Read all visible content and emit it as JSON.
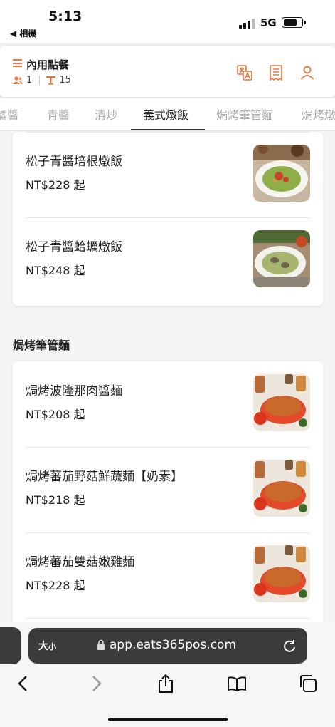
{
  "status_bar": {
    "time": "5:13",
    "back_label": "◀ 相機",
    "network": "5G"
  },
  "header": {
    "title": "內用點餐",
    "guests": "1",
    "table": "15",
    "icons": [
      "translate-icon",
      "receipt-icon",
      "user-icon"
    ]
  },
  "tabs": [
    {
      "label": "橘醬"
    },
    {
      "label": "青醬"
    },
    {
      "label": "清炒"
    },
    {
      "label": "義式燉飯"
    },
    {
      "label": "焗烤筆管麵"
    },
    {
      "label": "焗烤燉"
    }
  ],
  "active_tab": "義式燉飯",
  "risotto_items": [
    {
      "name": "松子青醬培根燉飯",
      "price": "NT$228 起"
    },
    {
      "name": "松子青醬蛤蠣燉飯",
      "price": "NT$248 起"
    }
  ],
  "baked_section": {
    "title": "焗烤筆管麵",
    "items": [
      {
        "name": "焗烤波隆那肉醬麵",
        "price": "NT$208 起"
      },
      {
        "name": "焗烤蕃茄野菇鮮蔬麵【奶素】",
        "price": "NT$218 起"
      },
      {
        "name": "焗烤蕃茄雙菇嫩雞麵",
        "price": "NT$228 起"
      }
    ]
  },
  "browser": {
    "text_size_big": "大",
    "text_size_small": "小",
    "url": "app.eats365pos.com"
  },
  "colors": {
    "accent": "#e8743b",
    "pesto": "#7fae3a",
    "tomato": "#d8451f"
  }
}
